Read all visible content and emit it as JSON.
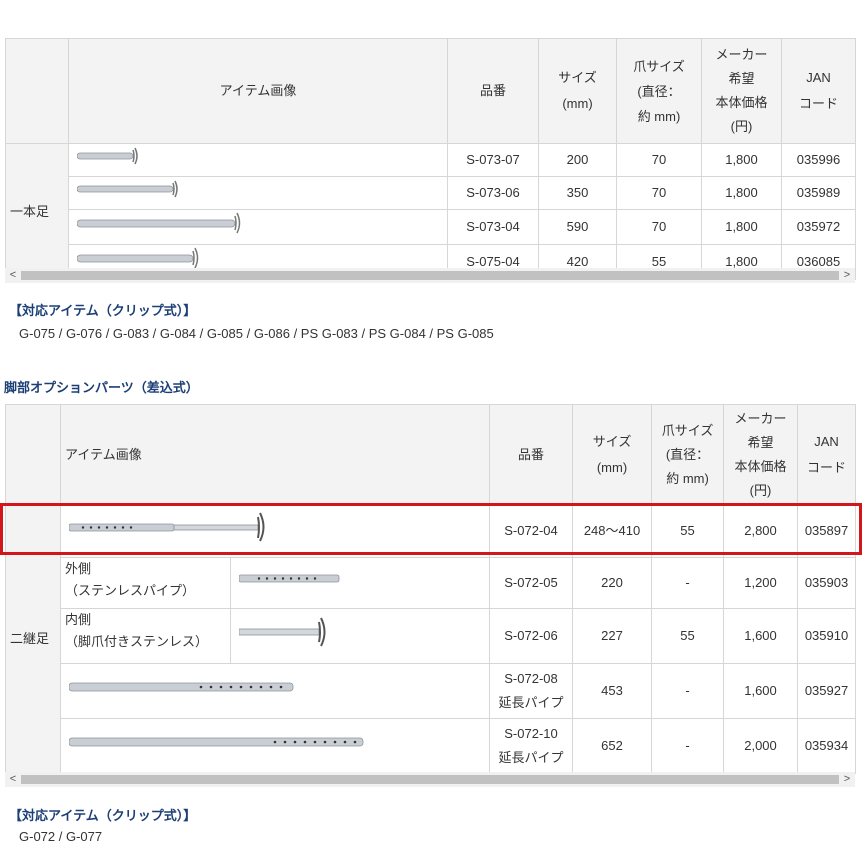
{
  "table1": {
    "headers": [
      "",
      "アイテム画像",
      "品番",
      "サイズ\n(mm)",
      "爪サイズ\n(直径：\n約 mm)",
      "メーカー\n希望\n本体価格\n(円)",
      "JAN\nコード"
    ],
    "category": "一本足",
    "rows": [
      {
        "code": "S-073-07",
        "size": "200",
        "claw": "70",
        "price": "1,800",
        "jan": "035996"
      },
      {
        "code": "S-073-06",
        "size": "350",
        "claw": "70",
        "price": "1,800",
        "jan": "035989"
      },
      {
        "code": "S-073-04",
        "size": "590",
        "claw": "70",
        "price": "1,800",
        "jan": "035972"
      },
      {
        "code": "S-075-04",
        "size": "420",
        "claw": "55",
        "price": "1,800",
        "jan": "036085"
      }
    ]
  },
  "compat1": {
    "title": "【対応アイテム（クリップ式）】",
    "items": "G-075 / G-076 / G-083 / G-084 / G-085 / G-086 / PS G-083 / PS G-084 / PS G-085"
  },
  "section2_title": "脚部オプションパーツ（差込式）",
  "table2": {
    "headers": [
      "",
      "アイテム画像",
      "品番",
      "サイズ\n(mm)",
      "爪サイズ\n(直径：\n約 mm)",
      "メーカー\n希望\n本体価格\n(円)",
      "JAN\nコード"
    ],
    "category": "二継足",
    "rows": [
      {
        "code": "S-072-04",
        "size": "248〜410",
        "claw": "55",
        "price": "2,800",
        "jan": "035897"
      },
      {
        "label1": "外側",
        "label2": "（ステンレスパイプ）",
        "code": "S-072-05",
        "size": "220",
        "claw": "-",
        "price": "1,200",
        "jan": "035903"
      },
      {
        "label1": "内側",
        "label2": "（脚爪付きステンレス）",
        "code": "S-072-06",
        "size": "227",
        "claw": "55",
        "price": "1,600",
        "jan": "035910"
      },
      {
        "code": "S-072-08",
        "code2": "延長パイプ",
        "size": "453",
        "claw": "-",
        "price": "1,600",
        "jan": "035927"
      },
      {
        "code": "S-072-10",
        "code2": "延長パイプ",
        "size": "652",
        "claw": "-",
        "price": "2,000",
        "jan": "035934"
      }
    ]
  },
  "compat2": {
    "title": "【対応アイテム（クリップ式）】",
    "items": "G-072 / G-077"
  },
  "scroll": {
    "left": "<",
    "right": ">"
  },
  "colors": {
    "highlight": "#d3151c",
    "section_title": "#1d3f77",
    "header_bg": "#f3f3f3"
  }
}
